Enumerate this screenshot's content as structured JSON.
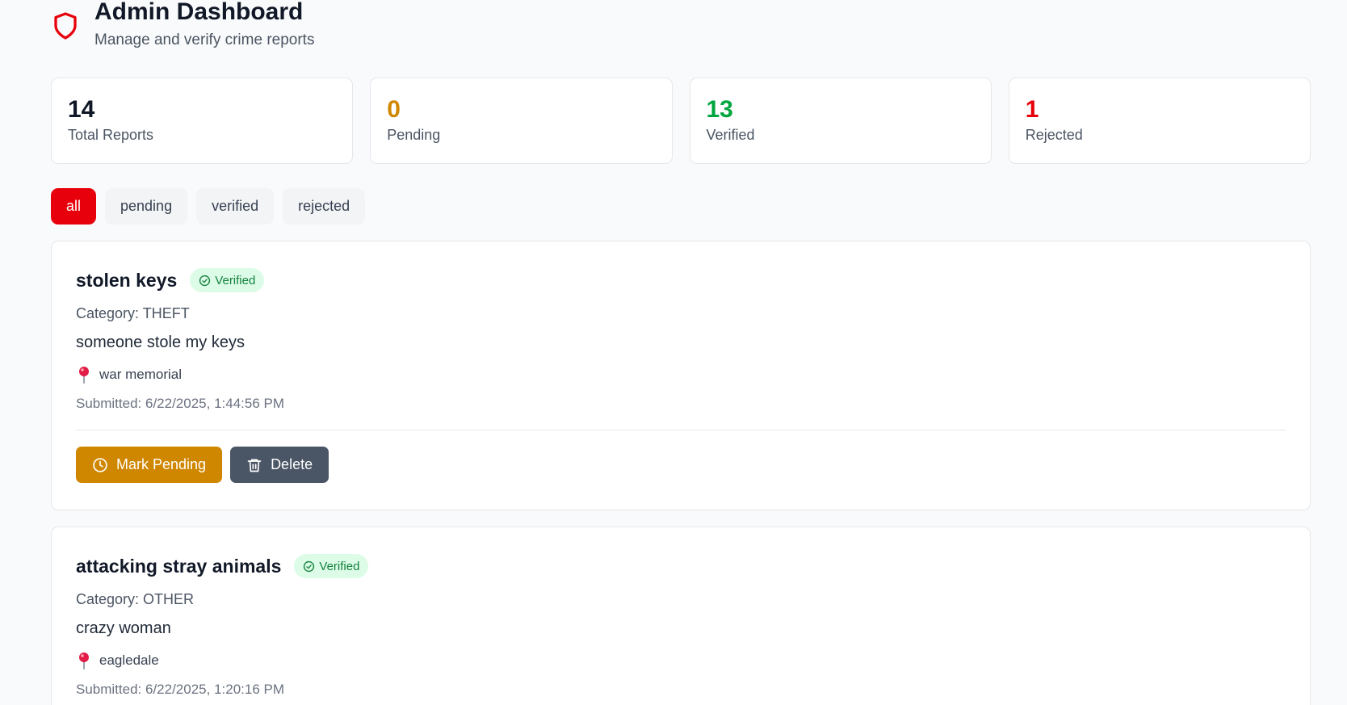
{
  "header": {
    "title": "Admin Dashboard",
    "subtitle": "Manage and verify crime reports",
    "icon": "shield-icon"
  },
  "stats": [
    {
      "value": "14",
      "label": "Total Reports",
      "color": "#101828"
    },
    {
      "value": "0",
      "label": "Pending",
      "color": "#d08700"
    },
    {
      "value": "13",
      "label": "Verified",
      "color": "#00a63e"
    },
    {
      "value": "1",
      "label": "Rejected",
      "color": "#e7000b"
    }
  ],
  "filters": {
    "active": "all",
    "items": [
      "all",
      "pending",
      "verified",
      "rejected"
    ]
  },
  "reports": [
    {
      "title": "stolen keys",
      "status": "Verified",
      "category": "Category: THEFT",
      "description": "someone stole my keys",
      "location": "war memorial",
      "submitted": "Submitted: 6/22/2025, 1:44:56 PM",
      "actions": {
        "pending": "Mark Pending",
        "delete": "Delete"
      }
    },
    {
      "title": "attacking stray animals",
      "status": "Verified",
      "category": "Category: OTHER",
      "description": "crazy woman",
      "location": "eagledale",
      "submitted": "Submitted: 6/22/2025, 1:20:16 PM"
    }
  ],
  "colors": {
    "accent": "#e7000b",
    "verified_badge_bg": "#dcfce7",
    "verified_badge_text": "#15803d",
    "pending_button": "#d08700",
    "delete_button": "#4a5565"
  }
}
